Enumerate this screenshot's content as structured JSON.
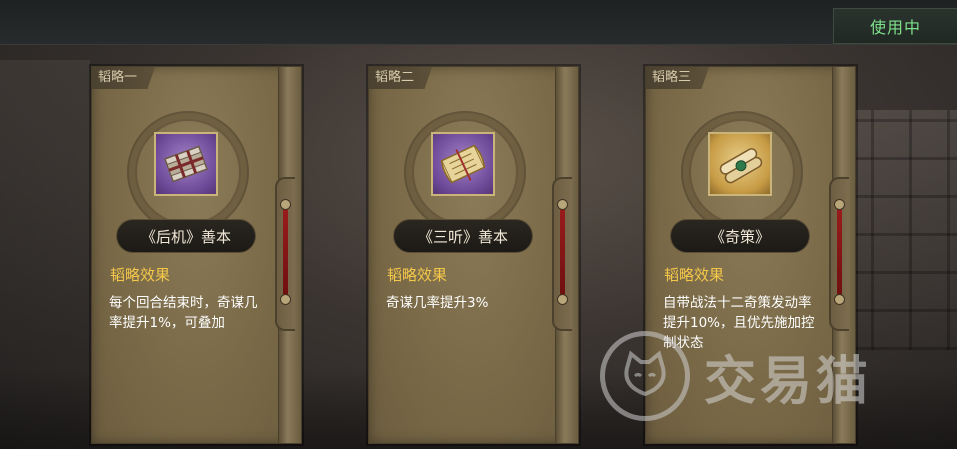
{
  "header": {
    "status_label": "使用中"
  },
  "cards": [
    {
      "tab": "韬略一",
      "icon": "bundled-books-icon",
      "icon_bg": "purple",
      "name": "《后机》善本",
      "effect_title": "韬略效果",
      "effect_desc": "每个回合结束时，奇谋几率提升1%，可叠加"
    },
    {
      "tab": "韬略二",
      "icon": "open-scroll-icon",
      "icon_bg": "purple",
      "name": "《三听》善本",
      "effect_title": "韬略效果",
      "effect_desc": "奇谋几率提升3%"
    },
    {
      "tab": "韬略三",
      "icon": "rolled-scrolls-icon",
      "icon_bg": "gold",
      "name": "《奇策》",
      "effect_title": "韬略效果",
      "effect_desc": "自带战法十二奇策发动率提升10%，且优先施加控制状态"
    }
  ],
  "watermark": {
    "text": "交易猫",
    "icon": "cat-logo-icon"
  },
  "colors": {
    "status_green": "#7fe08a",
    "effect_title_gold": "#f5c84a",
    "slider_red": "#9b1c1c"
  }
}
